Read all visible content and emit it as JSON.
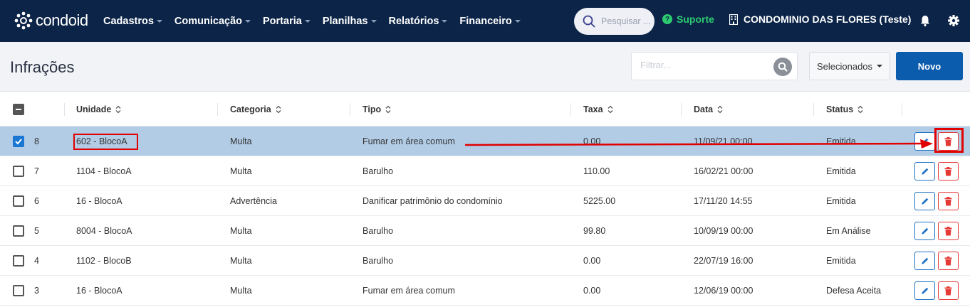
{
  "nav": {
    "logo_text": "condoid",
    "menu": [
      {
        "label": "Cadastros"
      },
      {
        "label": "Comunicação"
      },
      {
        "label": "Portaria"
      },
      {
        "label": "Planilhas"
      },
      {
        "label": "Relatórios"
      },
      {
        "label": "Financeiro"
      }
    ],
    "search_placeholder": "Pesquisar ...",
    "support_label": "Suporte",
    "condo_name": "CONDOMINIO DAS FLORES (Teste)",
    "colors": {
      "navbar": "#0b2447",
      "support": "#2ecc71"
    }
  },
  "toolbar": {
    "title": "Infrações",
    "filter_placeholder": "Filtrar...",
    "selected_button": "Selecionados",
    "new_button": "Novo"
  },
  "table": {
    "columns": [
      "Unidade",
      "Categoria",
      "Tipo",
      "Taxa",
      "Data",
      "Status"
    ],
    "rows": [
      {
        "id": "8",
        "unidade": "602 - BlocoA",
        "categoria": "Multa",
        "tipo": "Fumar em área comum",
        "taxa": "0.00",
        "data": "11/09/21 00:00",
        "status": "Emitida",
        "selected": true
      },
      {
        "id": "7",
        "unidade": "1104 - BlocoA",
        "categoria": "Multa",
        "tipo": "Barulho",
        "taxa": "110.00",
        "data": "16/02/21 00:00",
        "status": "Emitida",
        "selected": false
      },
      {
        "id": "6",
        "unidade": "16 - BlocoA",
        "categoria": "Advertência",
        "tipo": "Danificar patrimônio do condomínio",
        "taxa": "5225.00",
        "data": "17/11/20 14:55",
        "status": "Emitida",
        "selected": false
      },
      {
        "id": "5",
        "unidade": "8004 - BlocoA",
        "categoria": "Multa",
        "tipo": "Barulho",
        "taxa": "99.80",
        "data": "10/09/19 00:00",
        "status": "Em Análise",
        "selected": false
      },
      {
        "id": "4",
        "unidade": "1102 - BlocoB",
        "categoria": "Multa",
        "tipo": "Barulho",
        "taxa": "0.00",
        "data": "22/07/19 16:00",
        "status": "Emitida",
        "selected": false
      },
      {
        "id": "3",
        "unidade": "16 - BlocoA",
        "categoria": "Multa",
        "tipo": "Fumar em área comum",
        "taxa": "0.00",
        "data": "12/06/19 00:00",
        "status": "Defesa Aceita",
        "selected": false
      }
    ],
    "colors": {
      "selected_row": "#b2cce6",
      "edit": "#2274c5",
      "delete": "#e53935",
      "annotation": "#e00000"
    }
  }
}
